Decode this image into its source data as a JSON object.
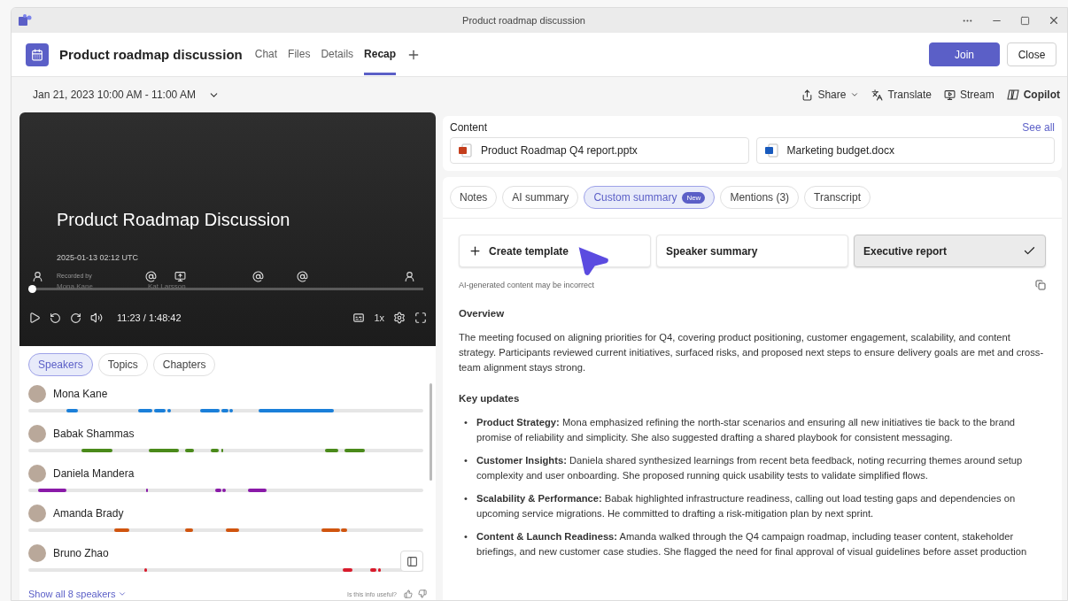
{
  "window": {
    "title": "Product roadmap discussion"
  },
  "header": {
    "title": "Product roadmap discussion",
    "tabs": [
      {
        "label": "Chat",
        "selected": false
      },
      {
        "label": "Files",
        "selected": false
      },
      {
        "label": "Details",
        "selected": false
      },
      {
        "label": "Recap",
        "selected": true
      }
    ],
    "buttons": [
      {
        "label": "Join",
        "kind": "primary"
      },
      {
        "label": "Close",
        "kind": "secondary"
      }
    ]
  },
  "toolbar": {
    "date": "Jan 21, 2023 10:00 AM - 11:00 AM",
    "actions": [
      {
        "label": "Share",
        "kind": "share"
      },
      {
        "label": "Translate",
        "kind": "translate"
      },
      {
        "label": "Stream",
        "kind": "stream"
      },
      {
        "label": "Copilot",
        "kind": "copilot"
      }
    ]
  },
  "video": {
    "title": "Product Roadmap Discussion",
    "timestamp": "2025-01-13 02:12 UTC",
    "time": "11:23 / 1:48:42",
    "speed": "1x",
    "level": 0.01,
    "markers": [
      {
        "kind": "person",
        "caption": "Recorded by",
        "name": "Mona Kane"
      },
      {
        "kind": "mention"
      },
      {
        "kind": "share",
        "name": "Kat Larsson"
      },
      {
        "kind": "mention"
      },
      {
        "kind": "mention"
      },
      {
        "kind": "person"
      }
    ]
  },
  "panel_tabs": [
    {
      "label": "Speakers",
      "selected": true
    },
    {
      "label": "Topics",
      "selected": false
    },
    {
      "label": "Chapters",
      "selected": false
    }
  ],
  "speakers": [
    {
      "name": "Mona Kane",
      "color": "#1a7fd9"
    },
    {
      "name": "Babak Shammas",
      "color": "#4a8a1a"
    },
    {
      "name": "Daniela Mandera",
      "color": "#8a1aa8"
    },
    {
      "name": "Amanda Brady",
      "color": "#d0550f"
    },
    {
      "name": "Bruno Zhao",
      "color": "#d81b2c"
    }
  ],
  "panel_footer": {
    "link": "Show all 8 speakers",
    "feedback": "Is this info useful?"
  },
  "content": {
    "title": "Content",
    "link": "See all",
    "files": [
      {
        "name": "Product Roadmap Q4 report.pptx",
        "kind": "pptx"
      },
      {
        "name": "Marketing budget.docx",
        "kind": "docx"
      }
    ]
  },
  "summary_tabs": [
    {
      "label": "Notes",
      "selected": false
    },
    {
      "label": "AI summary",
      "selected": false
    },
    {
      "label": "Custom summary",
      "selected": true,
      "badge": "New"
    },
    {
      "label": "Mentions (3)",
      "selected": false
    },
    {
      "label": "Transcript",
      "selected": false
    }
  ],
  "templates": [
    {
      "label": "Create template",
      "kind": "create",
      "selected": false
    },
    {
      "label": "Speaker summary",
      "kind": "template",
      "selected": false
    },
    {
      "label": "Executive report",
      "kind": "template",
      "selected": true
    }
  ],
  "disclaimer": "AI-generated content may be incorrect",
  "overview": {
    "heading": "Overview",
    "text": "The meeting focused on aligning priorities for Q4, covering product positioning, customer engagement, scalability, and content strategy. Participants reviewed current initiatives, surfaced risks, and proposed next steps to ensure delivery goals are met and cross-team alignment stays strong."
  },
  "key_updates": {
    "heading": "Key updates",
    "items": [
      {
        "marker": "•",
        "text": "**Product Strategy:** Mona emphasized refining the north-star scenarios and ensuring all new initiatives tie back to the brand promise of reliability and simplicity. She also suggested drafting a shared playbook for consistent messaging."
      },
      {
        "marker": "•",
        "text": "**Customer Insights:** Daniela shared synthesized learnings from recent beta feedback, noting recurring themes around setup complexity and user onboarding. She proposed running quick usability tests to validate simplified flows."
      },
      {
        "marker": "•",
        "text": "**Scalability & Performance:** Babak highlighted infrastructure readiness, calling out load testing gaps and dependencies on upcoming service migrations. He committed to drafting a risk-mitigation plan by next sprint."
      },
      {
        "marker": "•",
        "text": "**Content & Launch Readiness:** Amanda walked through the Q4 campaign roadmap, including teaser content, stakeholder briefings, and new customer case studies. She flagged the need for final approval of visual guidelines before asset production"
      }
    ]
  }
}
